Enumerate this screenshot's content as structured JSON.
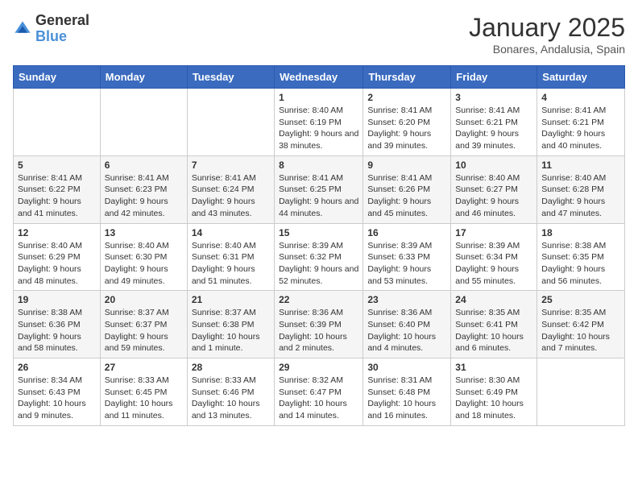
{
  "header": {
    "logo_line1": "General",
    "logo_line2": "Blue",
    "month": "January 2025",
    "location": "Bonares, Andalusia, Spain"
  },
  "weekdays": [
    "Sunday",
    "Monday",
    "Tuesday",
    "Wednesday",
    "Thursday",
    "Friday",
    "Saturday"
  ],
  "weeks": [
    [
      {
        "day": "",
        "info": ""
      },
      {
        "day": "",
        "info": ""
      },
      {
        "day": "",
        "info": ""
      },
      {
        "day": "1",
        "info": "Sunrise: 8:40 AM\nSunset: 6:19 PM\nDaylight: 9 hours and 38 minutes."
      },
      {
        "day": "2",
        "info": "Sunrise: 8:41 AM\nSunset: 6:20 PM\nDaylight: 9 hours and 39 minutes."
      },
      {
        "day": "3",
        "info": "Sunrise: 8:41 AM\nSunset: 6:21 PM\nDaylight: 9 hours and 39 minutes."
      },
      {
        "day": "4",
        "info": "Sunrise: 8:41 AM\nSunset: 6:21 PM\nDaylight: 9 hours and 40 minutes."
      }
    ],
    [
      {
        "day": "5",
        "info": "Sunrise: 8:41 AM\nSunset: 6:22 PM\nDaylight: 9 hours and 41 minutes."
      },
      {
        "day": "6",
        "info": "Sunrise: 8:41 AM\nSunset: 6:23 PM\nDaylight: 9 hours and 42 minutes."
      },
      {
        "day": "7",
        "info": "Sunrise: 8:41 AM\nSunset: 6:24 PM\nDaylight: 9 hours and 43 minutes."
      },
      {
        "day": "8",
        "info": "Sunrise: 8:41 AM\nSunset: 6:25 PM\nDaylight: 9 hours and 44 minutes."
      },
      {
        "day": "9",
        "info": "Sunrise: 8:41 AM\nSunset: 6:26 PM\nDaylight: 9 hours and 45 minutes."
      },
      {
        "day": "10",
        "info": "Sunrise: 8:40 AM\nSunset: 6:27 PM\nDaylight: 9 hours and 46 minutes."
      },
      {
        "day": "11",
        "info": "Sunrise: 8:40 AM\nSunset: 6:28 PM\nDaylight: 9 hours and 47 minutes."
      }
    ],
    [
      {
        "day": "12",
        "info": "Sunrise: 8:40 AM\nSunset: 6:29 PM\nDaylight: 9 hours and 48 minutes."
      },
      {
        "day": "13",
        "info": "Sunrise: 8:40 AM\nSunset: 6:30 PM\nDaylight: 9 hours and 49 minutes."
      },
      {
        "day": "14",
        "info": "Sunrise: 8:40 AM\nSunset: 6:31 PM\nDaylight: 9 hours and 51 minutes."
      },
      {
        "day": "15",
        "info": "Sunrise: 8:39 AM\nSunset: 6:32 PM\nDaylight: 9 hours and 52 minutes."
      },
      {
        "day": "16",
        "info": "Sunrise: 8:39 AM\nSunset: 6:33 PM\nDaylight: 9 hours and 53 minutes."
      },
      {
        "day": "17",
        "info": "Sunrise: 8:39 AM\nSunset: 6:34 PM\nDaylight: 9 hours and 55 minutes."
      },
      {
        "day": "18",
        "info": "Sunrise: 8:38 AM\nSunset: 6:35 PM\nDaylight: 9 hours and 56 minutes."
      }
    ],
    [
      {
        "day": "19",
        "info": "Sunrise: 8:38 AM\nSunset: 6:36 PM\nDaylight: 9 hours and 58 minutes."
      },
      {
        "day": "20",
        "info": "Sunrise: 8:37 AM\nSunset: 6:37 PM\nDaylight: 9 hours and 59 minutes."
      },
      {
        "day": "21",
        "info": "Sunrise: 8:37 AM\nSunset: 6:38 PM\nDaylight: 10 hours and 1 minute."
      },
      {
        "day": "22",
        "info": "Sunrise: 8:36 AM\nSunset: 6:39 PM\nDaylight: 10 hours and 2 minutes."
      },
      {
        "day": "23",
        "info": "Sunrise: 8:36 AM\nSunset: 6:40 PM\nDaylight: 10 hours and 4 minutes."
      },
      {
        "day": "24",
        "info": "Sunrise: 8:35 AM\nSunset: 6:41 PM\nDaylight: 10 hours and 6 minutes."
      },
      {
        "day": "25",
        "info": "Sunrise: 8:35 AM\nSunset: 6:42 PM\nDaylight: 10 hours and 7 minutes."
      }
    ],
    [
      {
        "day": "26",
        "info": "Sunrise: 8:34 AM\nSunset: 6:43 PM\nDaylight: 10 hours and 9 minutes."
      },
      {
        "day": "27",
        "info": "Sunrise: 8:33 AM\nSunset: 6:45 PM\nDaylight: 10 hours and 11 minutes."
      },
      {
        "day": "28",
        "info": "Sunrise: 8:33 AM\nSunset: 6:46 PM\nDaylight: 10 hours and 13 minutes."
      },
      {
        "day": "29",
        "info": "Sunrise: 8:32 AM\nSunset: 6:47 PM\nDaylight: 10 hours and 14 minutes."
      },
      {
        "day": "30",
        "info": "Sunrise: 8:31 AM\nSunset: 6:48 PM\nDaylight: 10 hours and 16 minutes."
      },
      {
        "day": "31",
        "info": "Sunrise: 8:30 AM\nSunset: 6:49 PM\nDaylight: 10 hours and 18 minutes."
      },
      {
        "day": "",
        "info": ""
      }
    ]
  ]
}
